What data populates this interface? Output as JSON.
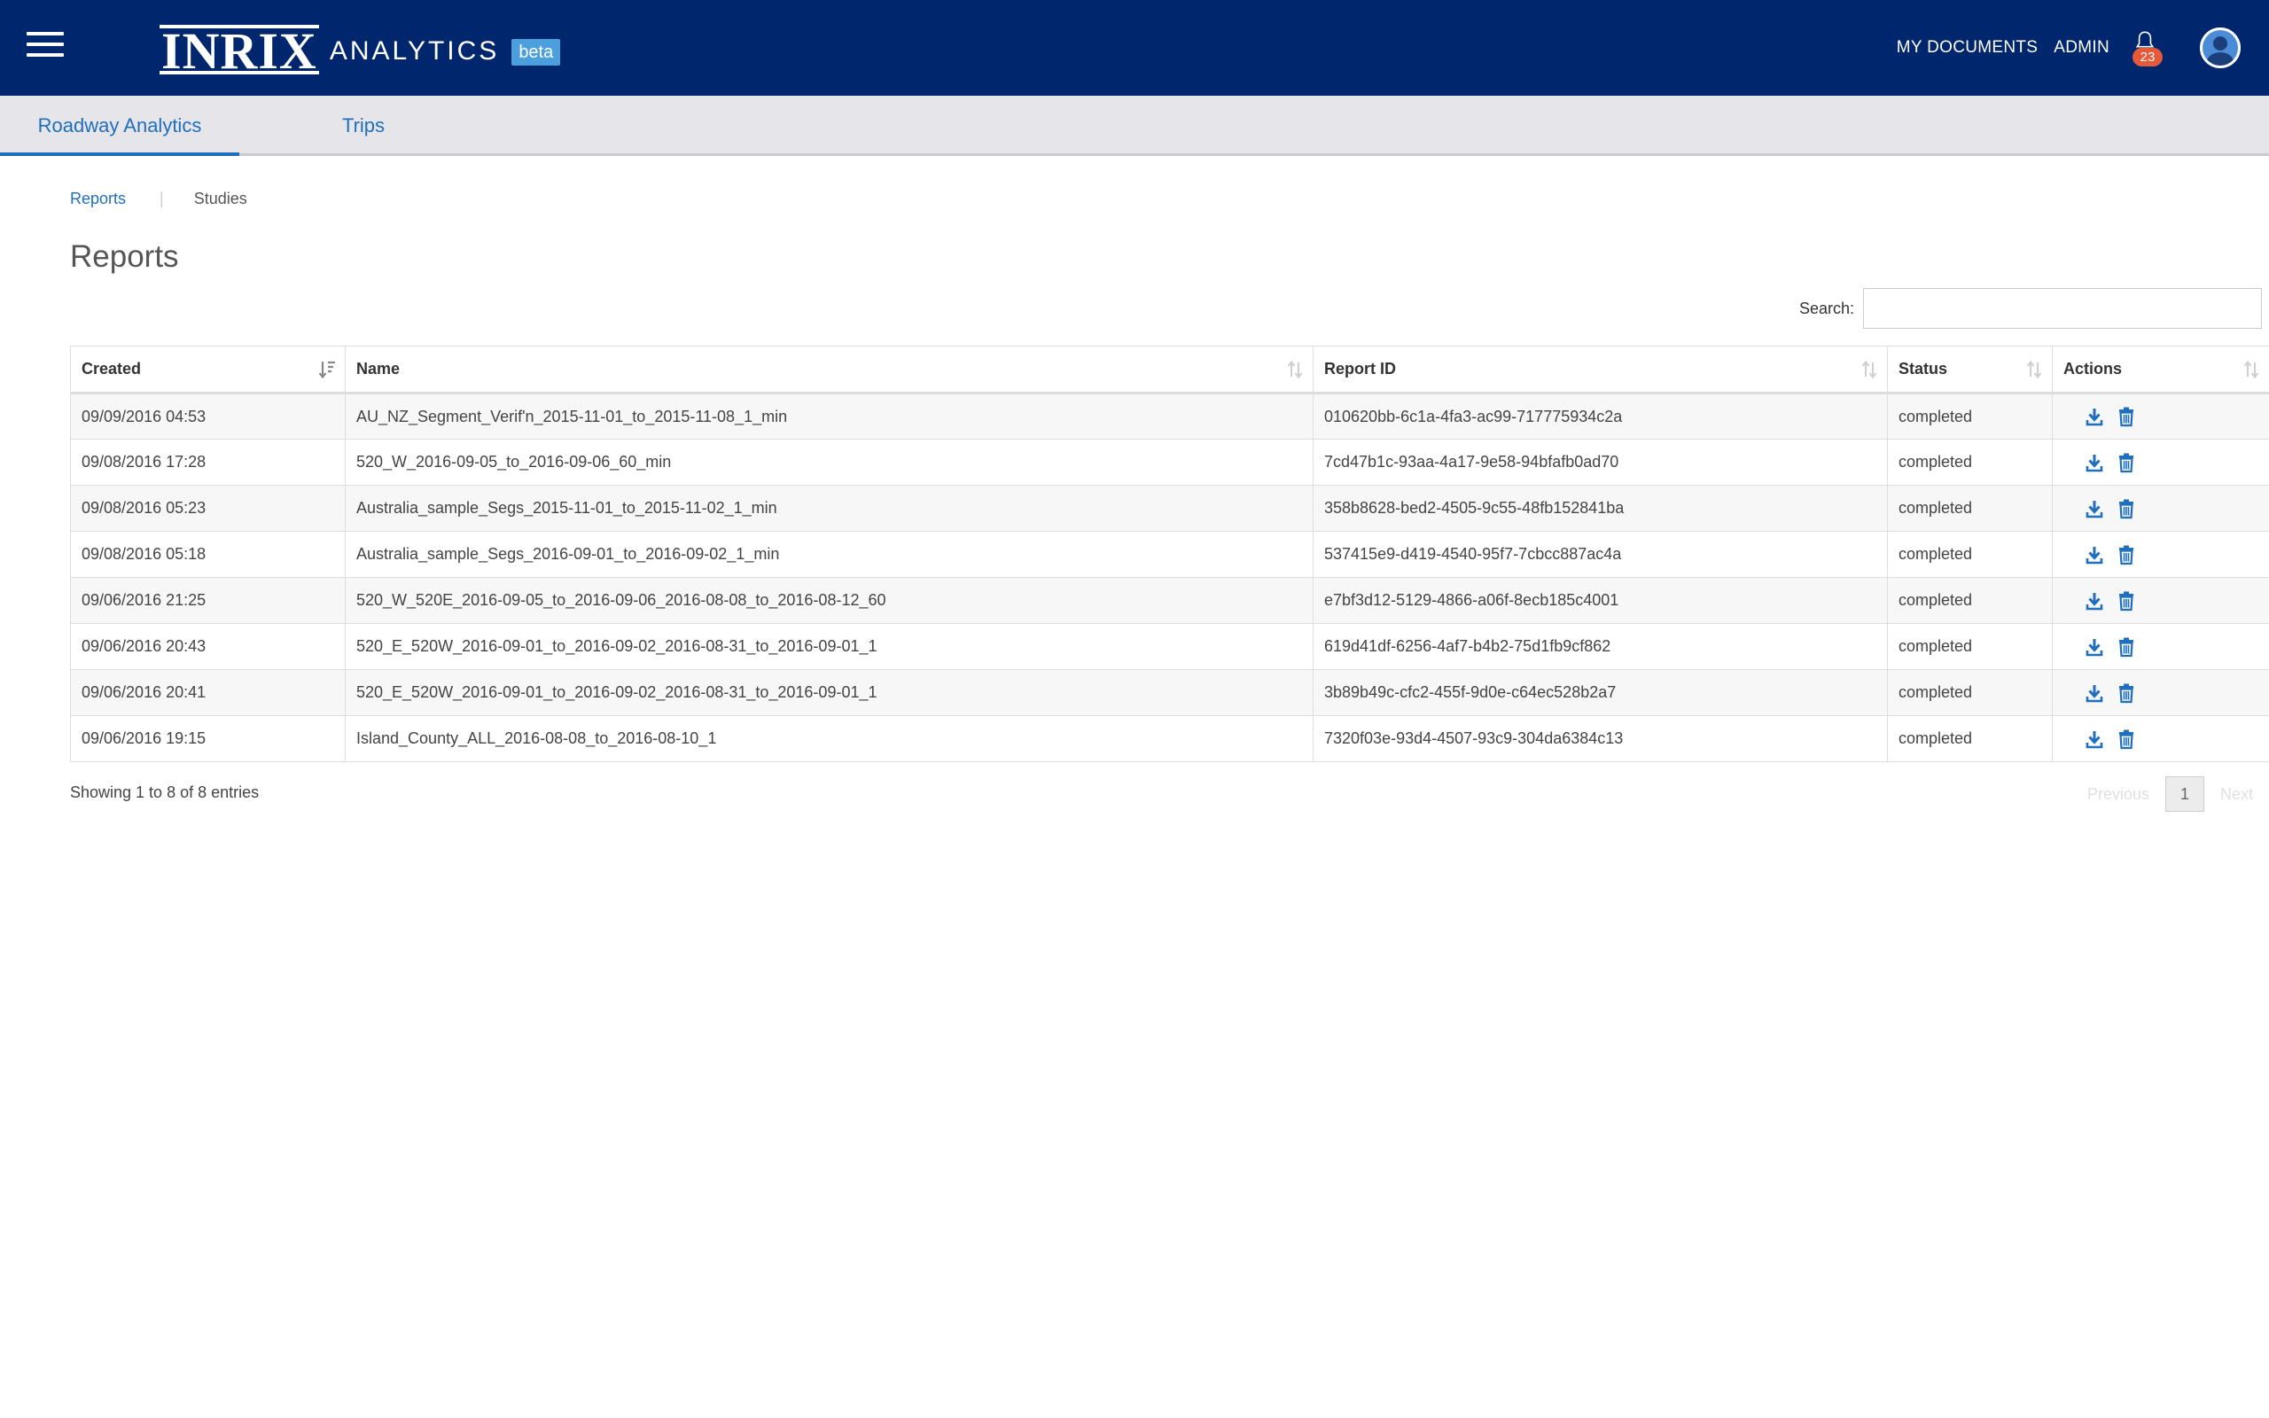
{
  "header": {
    "brand_logo": "INRIX",
    "brand_name": "ANALYTICS",
    "beta_label": "beta",
    "my_documents": "MY DOCUMENTS",
    "admin": "ADMIN",
    "notification_count": "23",
    "menu_icon": "hamburger-menu-icon",
    "bell_icon": "bell-icon",
    "avatar_icon": "user-avatar-icon"
  },
  "tabs": [
    {
      "label": "Roadway Analytics",
      "active": true
    },
    {
      "label": "Trips",
      "active": false
    }
  ],
  "subnav": {
    "reports": "Reports",
    "separator": "|",
    "studies": "Studies"
  },
  "page": {
    "title": "Reports"
  },
  "search": {
    "label": "Search:",
    "value": "",
    "placeholder": ""
  },
  "table": {
    "columns": [
      "Created",
      "Name",
      "Report ID",
      "Status",
      "Actions"
    ],
    "rows": [
      {
        "created": "09/09/2016 04:53",
        "name": "AU_NZ_Segment_Verif'n_2015-11-01_to_2015-11-08_1_min",
        "report_id": "010620bb-6c1a-4fa3-ac99-717775934c2a",
        "status": "completed"
      },
      {
        "created": "09/08/2016 17:28",
        "name": "520_W_2016-09-05_to_2016-09-06_60_min",
        "report_id": "7cd47b1c-93aa-4a17-9e58-94bfafb0ad70",
        "status": "completed"
      },
      {
        "created": "09/08/2016 05:23",
        "name": "Australia_sample_Segs_2015-11-01_to_2015-11-02_1_min",
        "report_id": "358b8628-bed2-4505-9c55-48fb152841ba",
        "status": "completed"
      },
      {
        "created": "09/08/2016 05:18",
        "name": "Australia_sample_Segs_2016-09-01_to_2016-09-02_1_min",
        "report_id": "537415e9-d419-4540-95f7-7cbcc887ac4a",
        "status": "completed"
      },
      {
        "created": "09/06/2016 21:25",
        "name": "520_W_520E_2016-09-05_to_2016-09-06_2016-08-08_to_2016-08-12_60",
        "report_id": "e7bf3d12-5129-4866-a06f-8ecb185c4001",
        "status": "completed"
      },
      {
        "created": "09/06/2016 20:43",
        "name": "520_E_520W_2016-09-01_to_2016-09-02_2016-08-31_to_2016-09-01_1",
        "report_id": "619d41df-6256-4af7-b4b2-75d1fb9cf862",
        "status": "completed"
      },
      {
        "created": "09/06/2016 20:41",
        "name": "520_E_520W_2016-09-01_to_2016-09-02_2016-08-31_to_2016-09-01_1",
        "report_id": "3b89b49c-cfc2-455f-9d0e-c64ec528b2a7",
        "status": "completed"
      },
      {
        "created": "09/06/2016 19:15",
        "name": "Island_County_ALL_2016-08-08_to_2016-08-10_1",
        "report_id": "7320f03e-93d4-4507-93c9-304da6384c13",
        "status": "completed"
      }
    ],
    "action_icons": [
      "download-icon",
      "trash-icon"
    ]
  },
  "footer": {
    "info": "Showing 1 to 8 of 8 entries",
    "previous": "Previous",
    "current_page": "1",
    "next": "Next"
  },
  "colors": {
    "header_bg": "#00266e",
    "link": "#1f6fbd",
    "badge": "#e55a3a",
    "beta": "#4a9fdc"
  }
}
